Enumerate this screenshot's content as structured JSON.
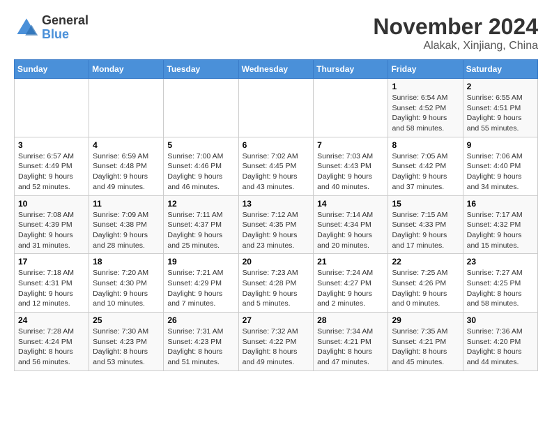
{
  "header": {
    "logo": {
      "general": "General",
      "blue": "Blue"
    },
    "title": "November 2024",
    "location": "Alakak, Xinjiang, China"
  },
  "calendar": {
    "weekdays": [
      "Sunday",
      "Monday",
      "Tuesday",
      "Wednesday",
      "Thursday",
      "Friday",
      "Saturday"
    ],
    "weeks": [
      [
        {
          "day": "",
          "info": ""
        },
        {
          "day": "",
          "info": ""
        },
        {
          "day": "",
          "info": ""
        },
        {
          "day": "",
          "info": ""
        },
        {
          "day": "",
          "info": ""
        },
        {
          "day": "1",
          "info": "Sunrise: 6:54 AM\nSunset: 4:52 PM\nDaylight: 9 hours and 58 minutes."
        },
        {
          "day": "2",
          "info": "Sunrise: 6:55 AM\nSunset: 4:51 PM\nDaylight: 9 hours and 55 minutes."
        }
      ],
      [
        {
          "day": "3",
          "info": "Sunrise: 6:57 AM\nSunset: 4:49 PM\nDaylight: 9 hours and 52 minutes."
        },
        {
          "day": "4",
          "info": "Sunrise: 6:59 AM\nSunset: 4:48 PM\nDaylight: 9 hours and 49 minutes."
        },
        {
          "day": "5",
          "info": "Sunrise: 7:00 AM\nSunset: 4:46 PM\nDaylight: 9 hours and 46 minutes."
        },
        {
          "day": "6",
          "info": "Sunrise: 7:02 AM\nSunset: 4:45 PM\nDaylight: 9 hours and 43 minutes."
        },
        {
          "day": "7",
          "info": "Sunrise: 7:03 AM\nSunset: 4:43 PM\nDaylight: 9 hours and 40 minutes."
        },
        {
          "day": "8",
          "info": "Sunrise: 7:05 AM\nSunset: 4:42 PM\nDaylight: 9 hours and 37 minutes."
        },
        {
          "day": "9",
          "info": "Sunrise: 7:06 AM\nSunset: 4:40 PM\nDaylight: 9 hours and 34 minutes."
        }
      ],
      [
        {
          "day": "10",
          "info": "Sunrise: 7:08 AM\nSunset: 4:39 PM\nDaylight: 9 hours and 31 minutes."
        },
        {
          "day": "11",
          "info": "Sunrise: 7:09 AM\nSunset: 4:38 PM\nDaylight: 9 hours and 28 minutes."
        },
        {
          "day": "12",
          "info": "Sunrise: 7:11 AM\nSunset: 4:37 PM\nDaylight: 9 hours and 25 minutes."
        },
        {
          "day": "13",
          "info": "Sunrise: 7:12 AM\nSunset: 4:35 PM\nDaylight: 9 hours and 23 minutes."
        },
        {
          "day": "14",
          "info": "Sunrise: 7:14 AM\nSunset: 4:34 PM\nDaylight: 9 hours and 20 minutes."
        },
        {
          "day": "15",
          "info": "Sunrise: 7:15 AM\nSunset: 4:33 PM\nDaylight: 9 hours and 17 minutes."
        },
        {
          "day": "16",
          "info": "Sunrise: 7:17 AM\nSunset: 4:32 PM\nDaylight: 9 hours and 15 minutes."
        }
      ],
      [
        {
          "day": "17",
          "info": "Sunrise: 7:18 AM\nSunset: 4:31 PM\nDaylight: 9 hours and 12 minutes."
        },
        {
          "day": "18",
          "info": "Sunrise: 7:20 AM\nSunset: 4:30 PM\nDaylight: 9 hours and 10 minutes."
        },
        {
          "day": "19",
          "info": "Sunrise: 7:21 AM\nSunset: 4:29 PM\nDaylight: 9 hours and 7 minutes."
        },
        {
          "day": "20",
          "info": "Sunrise: 7:23 AM\nSunset: 4:28 PM\nDaylight: 9 hours and 5 minutes."
        },
        {
          "day": "21",
          "info": "Sunrise: 7:24 AM\nSunset: 4:27 PM\nDaylight: 9 hours and 2 minutes."
        },
        {
          "day": "22",
          "info": "Sunrise: 7:25 AM\nSunset: 4:26 PM\nDaylight: 9 hours and 0 minutes."
        },
        {
          "day": "23",
          "info": "Sunrise: 7:27 AM\nSunset: 4:25 PM\nDaylight: 8 hours and 58 minutes."
        }
      ],
      [
        {
          "day": "24",
          "info": "Sunrise: 7:28 AM\nSunset: 4:24 PM\nDaylight: 8 hours and 56 minutes."
        },
        {
          "day": "25",
          "info": "Sunrise: 7:30 AM\nSunset: 4:23 PM\nDaylight: 8 hours and 53 minutes."
        },
        {
          "day": "26",
          "info": "Sunrise: 7:31 AM\nSunset: 4:23 PM\nDaylight: 8 hours and 51 minutes."
        },
        {
          "day": "27",
          "info": "Sunrise: 7:32 AM\nSunset: 4:22 PM\nDaylight: 8 hours and 49 minutes."
        },
        {
          "day": "28",
          "info": "Sunrise: 7:34 AM\nSunset: 4:21 PM\nDaylight: 8 hours and 47 minutes."
        },
        {
          "day": "29",
          "info": "Sunrise: 7:35 AM\nSunset: 4:21 PM\nDaylight: 8 hours and 45 minutes."
        },
        {
          "day": "30",
          "info": "Sunrise: 7:36 AM\nSunset: 4:20 PM\nDaylight: 8 hours and 44 minutes."
        }
      ]
    ]
  }
}
